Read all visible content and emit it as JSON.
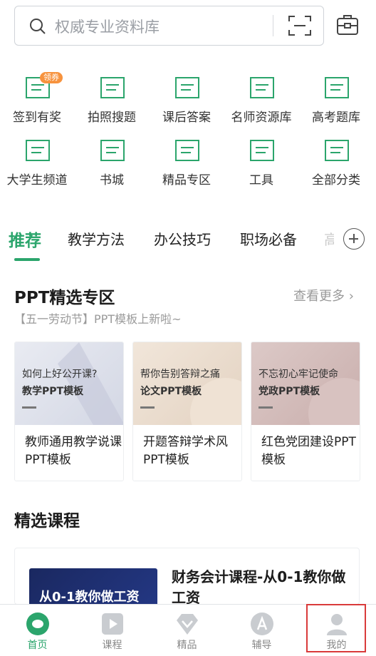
{
  "search": {
    "placeholder": "权威专业资料库"
  },
  "grid": [
    {
      "label": "签到有奖",
      "badge": "领券"
    },
    {
      "label": "拍照搜题"
    },
    {
      "label": "课后答案"
    },
    {
      "label": "名师资源库"
    },
    {
      "label": "高考题库"
    },
    {
      "label": "大学生频道"
    },
    {
      "label": "书城"
    },
    {
      "label": "精品专区"
    },
    {
      "label": "工具"
    },
    {
      "label": "全部分类"
    }
  ],
  "tabs": [
    {
      "label": "推荐",
      "active": true
    },
    {
      "label": "教学方法"
    },
    {
      "label": "办公技巧"
    },
    {
      "label": "职场必备"
    },
    {
      "label": "高"
    }
  ],
  "ppt_section": {
    "title": "PPT精选专区",
    "more": "查看更多",
    "subtitle": "【五一劳动节】PPT模板上新啦~",
    "cards": [
      {
        "thumb_line1": "如何上好公开课?",
        "thumb_line2": "教学PPT模板",
        "caption": "教师通用教学说课PPT模板"
      },
      {
        "thumb_line1": "帮你告别答辩之痛",
        "thumb_line2": "论文PPT模板",
        "caption": "开题答辩学术风PPT模板"
      },
      {
        "thumb_line1": "不忘初心牢记使命",
        "thumb_line2": "党政PPT模板",
        "caption": "红色党团建设PPT模板"
      }
    ]
  },
  "course_section": {
    "title": "精选课程",
    "course": {
      "thumb_text": "从0-1教你做工资",
      "title": "财务会计课程-从0-1教你做工资"
    }
  },
  "bottom_nav": [
    {
      "label": "首页",
      "icon": "home-icon",
      "active": true
    },
    {
      "label": "课程",
      "icon": "play-icon"
    },
    {
      "label": "精品",
      "icon": "diamond-icon"
    },
    {
      "label": "辅导",
      "icon": "a-badge-icon"
    },
    {
      "label": "我的",
      "icon": "user-icon"
    }
  ],
  "colors": {
    "accent": "#2ba56c",
    "badge": "#f7933e",
    "highlight": "#d93a3a"
  }
}
